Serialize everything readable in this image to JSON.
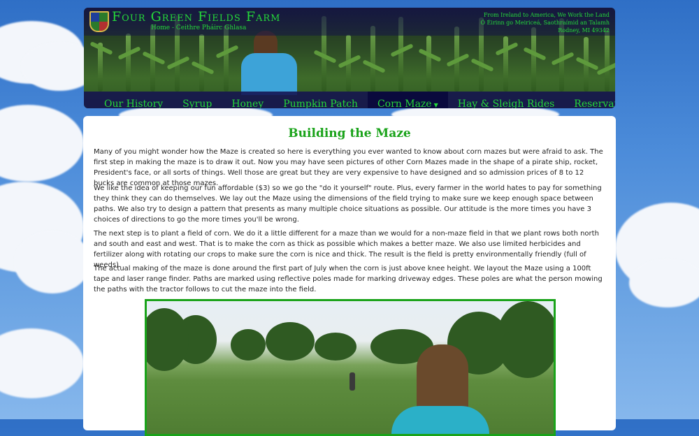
{
  "site": {
    "title": "Four Green Fields Farm",
    "subtitle": "Home - Ceithre Pháirc Ghlasa",
    "tagline": [
      "From Ireland to America, We Work the Land",
      "Ó Éirinn go Meiriceá, Saothraímid an Talamh",
      "Rodney, MI 49342"
    ],
    "crest_icon": "irish-four-provinces-crest"
  },
  "nav": {
    "items": [
      {
        "label": "Our History"
      },
      {
        "label": "Syrup"
      },
      {
        "label": "Honey"
      },
      {
        "label": "Pumpkin Patch"
      },
      {
        "label": "Corn Maze",
        "active": true,
        "dropdown": true
      },
      {
        "label": "Hay & Sleigh Rides"
      },
      {
        "label": "Reservations & Events"
      }
    ],
    "caret_icon": "caret-down-icon"
  },
  "content": {
    "heading": "Building the Maze",
    "paragraphs": [
      "Many of you might wonder how the Maze is created so here is everything you ever wanted to know about corn mazes but were afraid to ask. The first step in making the maze is to draw it out. Now you may have seen pictures of other Corn Mazes made in the shape of a pirate ship, rocket, President's face, or all sorts of things. Well those are great but they are very expensive to have designed and so admission prices of 8 to 12 bucks are common at those mazes.",
      "We like the idea of keeping our fun affordable ($3) so we go the \"do it yourself\" route. Plus, every farmer in the world hates to pay for something they think they can do themselves. We lay out the Maze using the dimensions of the field trying to make sure we keep enough space between paths. We also try to design a pattern that presents as many multiple choice situations as possible. Our attitude is the more times you have 3 choices of directions to go the more times you'll be wrong.",
      "The next step is to plant a field of corn. We do it a little different for a maze than we would for a non-maze field in that we plant rows both north and south and east and west. That is to make the corn as thick as possible which makes a better maze. We also use limited herbicides and fertilizer along with rotating our crops to make sure the corn is nice and thick. The result is the field is pretty environmentally friendly (full of weeds).",
      "The actual making of the maze is done around the first part of July when the corn is just above knee height. We layout the Maze using a 100ft tape and laser range finder. Paths are marked using reflective poles made for marking driveway edges. These poles are what the person mowing the paths with the tractor follows to cut the maze into the field."
    ]
  },
  "colors": {
    "accent_green": "#25d83a",
    "heading_green": "#1aa31a",
    "nav_bg": "#14125a",
    "sky_blue": "#4b8bd9"
  }
}
